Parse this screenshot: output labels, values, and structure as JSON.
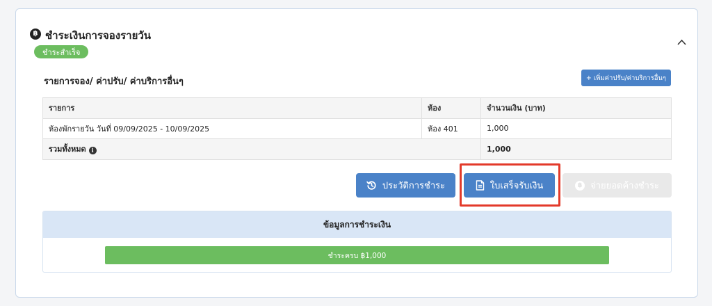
{
  "header": {
    "icon_glyph": "฿",
    "title": "ชำระเงินการจองรายวัน",
    "status_badge": "ชำระสำเร็จ",
    "status_color": "#6cbd5f"
  },
  "fees": {
    "section_title": "รายการจอง/ ค่าปรับ/ ค่าบริการอื่นๆ",
    "add_button_label": "+ เพิ่มค่าปรับ/ค่าบริการอื่นๆ",
    "columns": [
      "รายการ",
      "ห้อง",
      "จำนวนเงิน (บาท)"
    ],
    "rows": [
      {
        "item": "ห้องพักรายวัน วันที่ 09/09/2025 - 10/09/2025",
        "room": "ห้อง 401",
        "amount": "1,000"
      }
    ],
    "total_label": "รวมทั้งหมด",
    "total_info_icon": "i",
    "total_amount": "1,000"
  },
  "actions": {
    "history_label": "ประวัติการชำระ",
    "receipt_label": "ใบเสร็จรับเงิน",
    "pay_outstanding_label": "จ่ายยอดค้างชำระ",
    "coin_glyph": "฿",
    "accent_color": "#4a82c8",
    "highlight_color": "#e33a2a"
  },
  "payment_info": {
    "header": "ข้อมูลการชำระเงิน",
    "paid_bar_label": "ชำระครบ ฿1,000",
    "paid_progress": 1.0
  }
}
